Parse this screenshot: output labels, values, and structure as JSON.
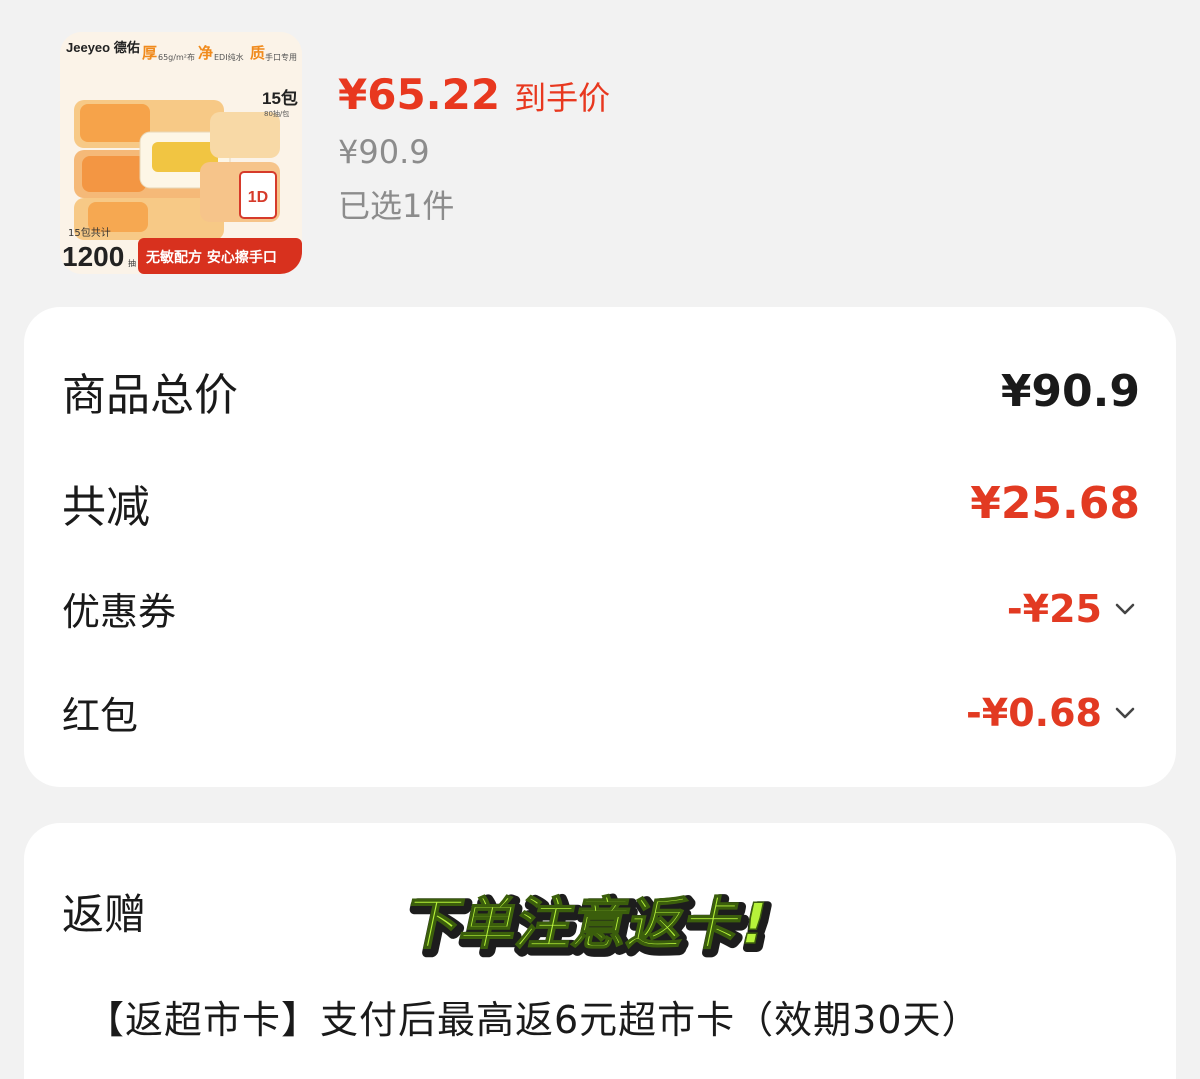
{
  "product": {
    "thumbnail": {
      "brand": "Jeeyeo 德佑",
      "tag_thick": "厚",
      "tag_thick_sub": "65g/m²布",
      "tag_clean": "净",
      "tag_clean_sub": "EDI纯水",
      "tag_quality": "质",
      "tag_quality_sub": "手口专用",
      "pack_badge": "15包",
      "pack_badge_sub": "80抽/包",
      "total_label": "15包共计",
      "total_value": "1200",
      "total_unit": "抽",
      "slogan": "无敏配方 安心擦手口"
    },
    "final_price": "¥65.22",
    "final_price_label": "到手价",
    "original_price": "¥90.9",
    "selected_count": "已选1件"
  },
  "summary": {
    "total": {
      "label": "商品总价",
      "value": "¥90.9"
    },
    "reduction": {
      "label": "共减",
      "value": "¥25.68"
    },
    "coupon": {
      "label": "优惠券",
      "value": "-¥25"
    },
    "red_packet": {
      "label": "红包",
      "value": "-¥0.68"
    }
  },
  "gift": {
    "title": "返赠",
    "banner_text": "下单注意返卡!",
    "description": "【返超市卡】支付后最高返6元超市卡（效期30天）"
  },
  "colors": {
    "accent_red": "#e23a22",
    "muted_text": "#8c8c8c",
    "banner_green": "#b6f23a"
  },
  "icons": [
    "chevron-down-icon"
  ]
}
